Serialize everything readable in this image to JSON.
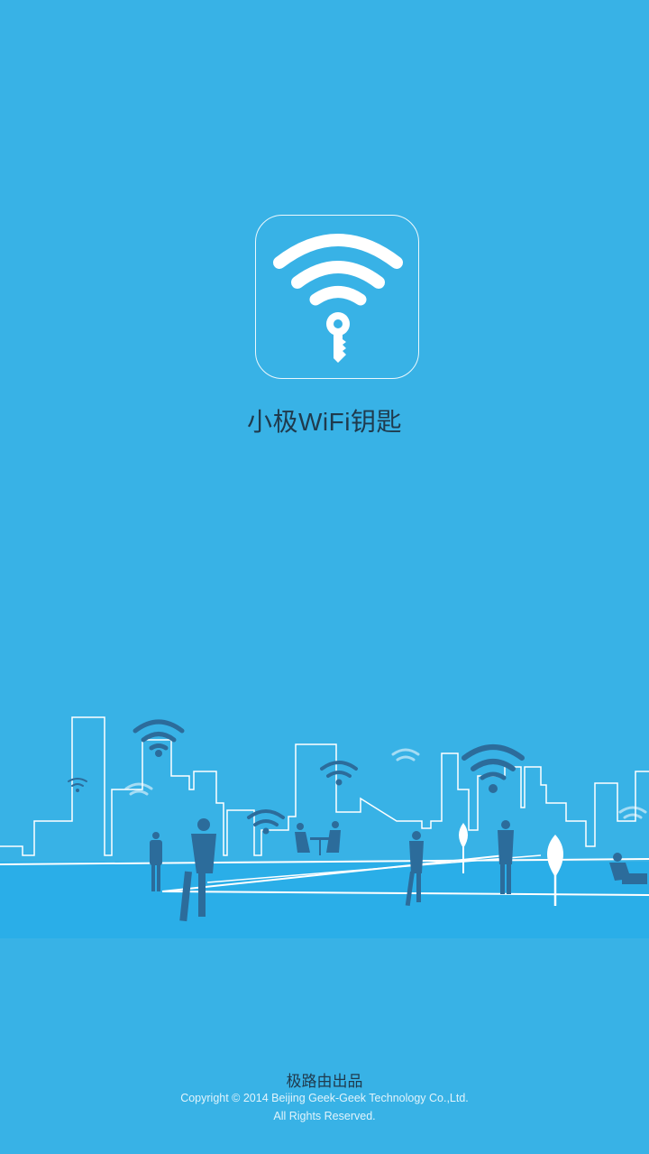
{
  "app": {
    "title": "小极WiFi钥匙",
    "icon": "wifi-key-icon"
  },
  "footer": {
    "brand": "极路由出品",
    "copyright": "Copyright © 2014 Beijing Geek-Geek Technology Co.,Ltd.",
    "rights": "All Rights Reserved."
  },
  "colors": {
    "background": "#38b2e6",
    "ground": "#2aaee8",
    "silhouette": "#2c6c9b"
  }
}
